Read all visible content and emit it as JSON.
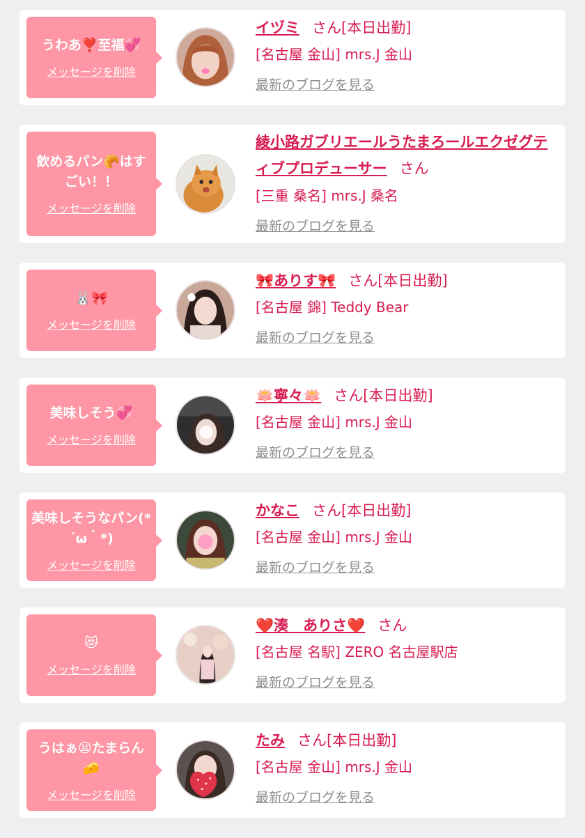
{
  "bubble_delete_label": "メッセージを削除",
  "blog_link_label": "最新のブログを見る",
  "accent_color": "#d81b50",
  "bubble_color": "#ff96a5",
  "items": [
    {
      "message": "うわあ❣️至福💞",
      "name": "イヅミ",
      "suffix": "さん[本日出勤]",
      "shop": "[名古屋 金山] mrs.J 金山",
      "avatar_icon": "avatar-photo-woman-orange-hair"
    },
    {
      "message": "飲めるパン🥐はすごい！！",
      "name": "綾小路ガブリエールうたまろールエクゼグティブプロデューサー",
      "suffix": "さん",
      "shop": "[三重 桑名] mrs.J 桑名",
      "avatar_icon": "avatar-photo-cat"
    },
    {
      "message": "🐰🎀",
      "name": "🎀ありす🎀",
      "suffix": "さん[本日出勤]",
      "shop": "[名古屋 錦] Teddy Bear",
      "avatar_icon": "avatar-photo-woman-dark-hair"
    },
    {
      "message": "美味しそう💞",
      "name": "🪷寧々🪷",
      "suffix": "さん[本日出勤]",
      "shop": "[名古屋 金山] mrs.J 金山",
      "avatar_icon": "avatar-photo-woman-car"
    },
    {
      "message": "美味しそうなパン(*´ω｀*)",
      "name": "かなこ",
      "suffix": "さん[本日出勤]",
      "shop": "[名古屋 金山] mrs.J 金山",
      "avatar_icon": "avatar-photo-woman-brown-hair"
    },
    {
      "message": "😻",
      "name": "❤️湊　ありさ❤️",
      "suffix": "さん",
      "shop": "[名古屋 名駅] ZERO 名古屋駅店",
      "avatar_icon": "avatar-photo-woman-pink-room"
    },
    {
      "message": "うはぁ😫たまらん🧀",
      "name": "たみ",
      "suffix": "さん[本日出勤]",
      "shop": "[名古屋 金山] mrs.J 金山",
      "avatar_icon": "avatar-photo-woman-strawberry"
    }
  ]
}
